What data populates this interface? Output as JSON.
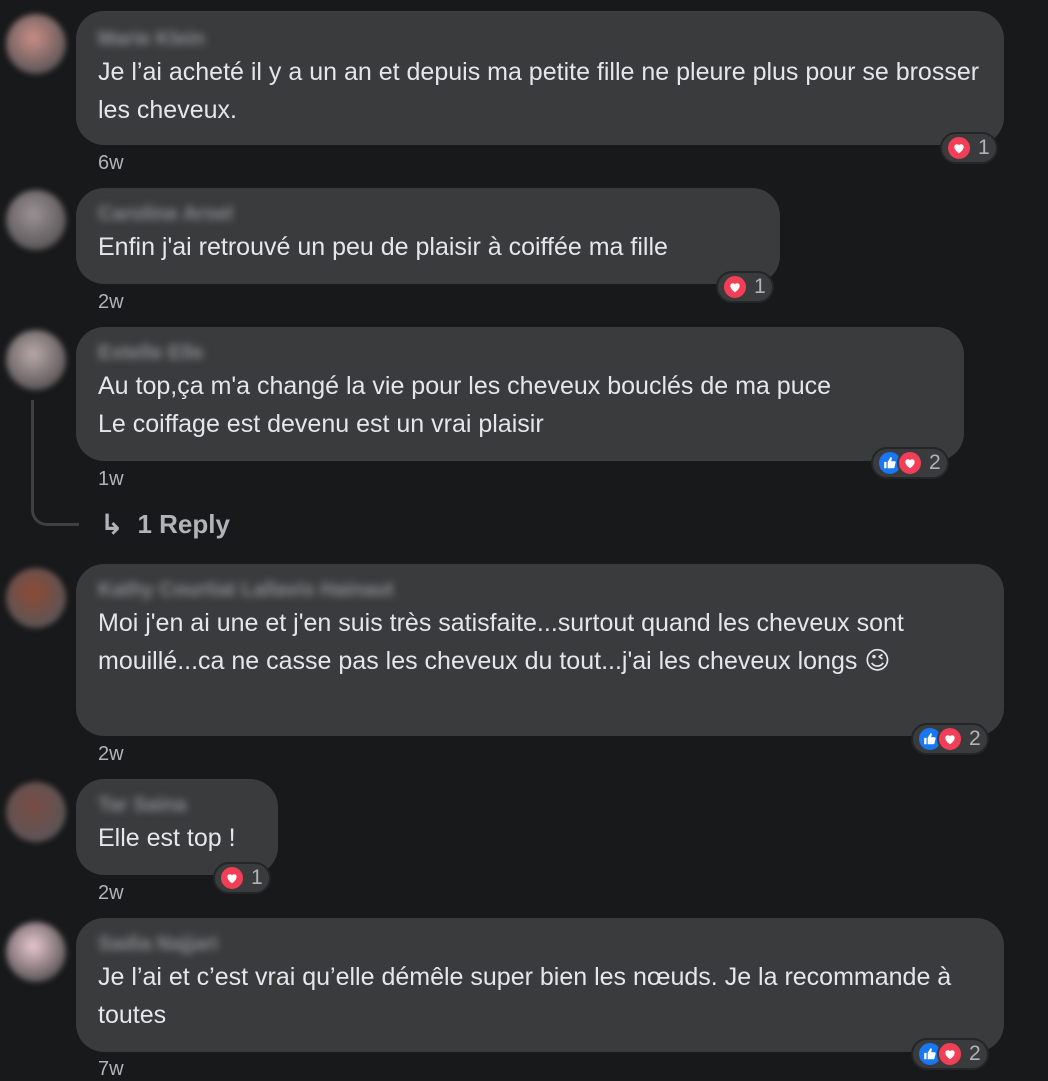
{
  "comments": [
    {
      "author": "Marie Klein",
      "text": "Je l’ai acheté il y a un an et depuis ma petite fille ne pleure plus pour se brosser les cheveux.",
      "time": "6w",
      "reactions": {
        "icons": [
          "heart-icon"
        ],
        "count": "1"
      },
      "avatar_color": "#c98e86"
    },
    {
      "author": "Caroline Arsel",
      "text": "Enfin j'ai retrouvé un peu de plaisir à coiffée ma fille",
      "time": "2w",
      "reactions": {
        "icons": [
          "heart-icon"
        ],
        "count": "1"
      },
      "avatar_color": "#9a9294"
    },
    {
      "author": "Estelle Elle",
      "text_lines": [
        "Au top,ça m'a changé la vie pour les cheveux bouclés de ma puce",
        "Le coiffage est devenu est un vrai plaisir"
      ],
      "time": "1w",
      "reactions": {
        "icons": [
          "like-icon",
          "heart-icon"
        ],
        "count": "2"
      },
      "replies_label": "1 Reply",
      "avatar_color": "#b9a9a8"
    },
    {
      "author": "Kathy Courtiat Lallavis Hainaut",
      "text": "Moi j'en ai une et j'en suis très satisfaite...surtout quand les cheveux sont mouillé...ca ne casse pas les cheveux du tout...j'ai les cheveux longs",
      "emoji": "😉",
      "time": "2w",
      "reactions": {
        "icons": [
          "like-icon",
          "heart-icon"
        ],
        "count": "2"
      },
      "avatar_color": "#8c4a35"
    },
    {
      "author": "Tar Saina",
      "text": "Elle est top !",
      "time": "2w",
      "reactions": {
        "icons": [
          "heart-icon"
        ],
        "count": "1"
      },
      "avatar_color": "#7a4c44"
    },
    {
      "author": "Sadia Najjari",
      "text": "Je l’ai et c’est vrai qu’elle démêle super bien les nœuds. Je la recommande à toutes",
      "time": "7w",
      "reactions": {
        "icons": [
          "like-icon",
          "heart-icon"
        ],
        "count": "2"
      },
      "avatar_color": "#e8c7cf"
    }
  ]
}
